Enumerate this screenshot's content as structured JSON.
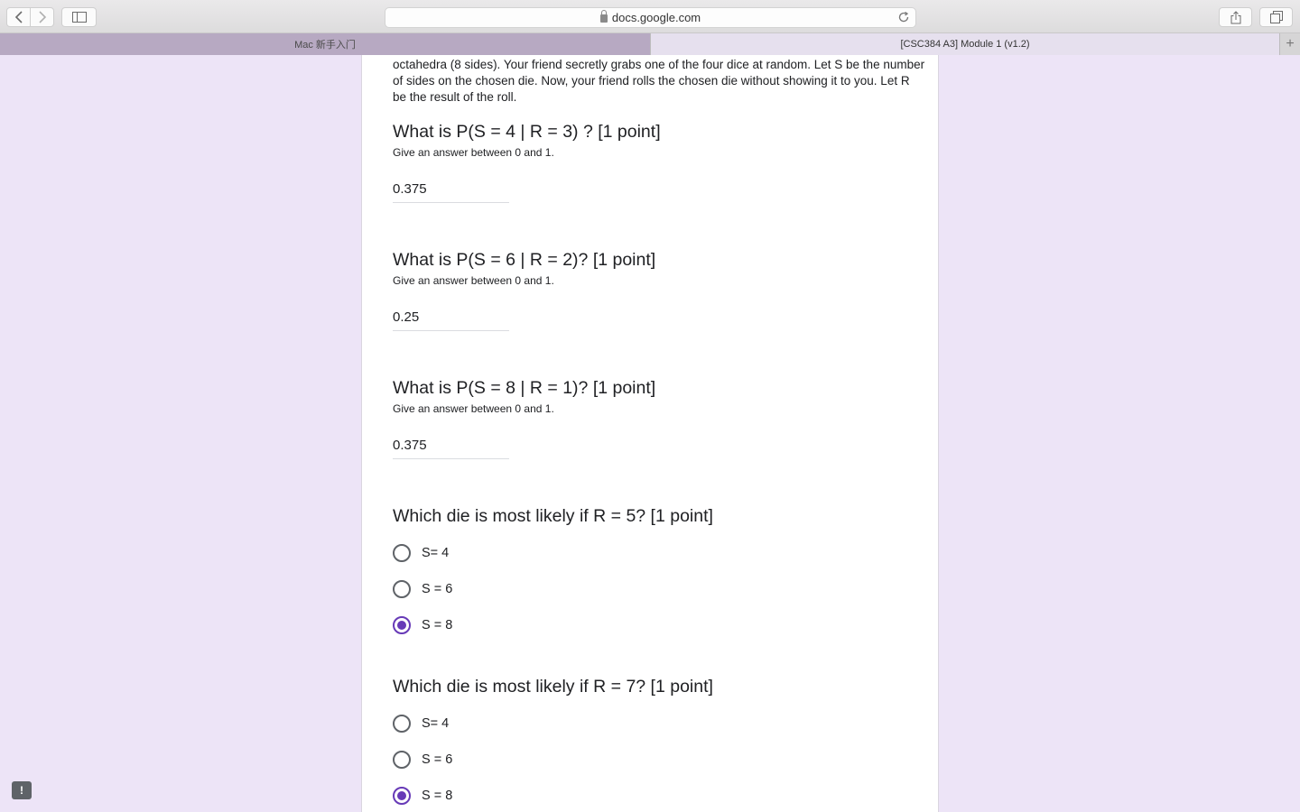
{
  "browser": {
    "url": "docs.google.com",
    "tabs": [
      {
        "label": "Mac 新手入门",
        "active": false
      },
      {
        "label": "[CSC384 A3] Module 1 (v1.2)",
        "active": true
      }
    ],
    "new_tab_label": "+"
  },
  "form": {
    "intro": "octahedra (8 sides). Your friend secretly grabs one of the four dice at random. Let S be the number of sides on the chosen die. Now, your friend rolls the chosen die without showing it to you. Let R be the result of the roll.",
    "short_questions": [
      {
        "title": "What is P(S = 4 | R = 3) ? [1 point]",
        "help": "Give an answer between 0 and 1.",
        "answer": "0.375"
      },
      {
        "title": "What is P(S = 6 | R = 2)? [1 point]",
        "help": "Give an answer between 0 and 1.",
        "answer": "0.25"
      },
      {
        "title": "What is P(S = 8 | R = 1)? [1 point]",
        "help": "Give an answer between 0 and 1.",
        "answer": "0.375"
      }
    ],
    "choice_questions": [
      {
        "title": "Which die is most likely if R = 5? [1 point]",
        "options": [
          "S= 4",
          "S = 6",
          "S = 8"
        ],
        "selected": "S = 8"
      },
      {
        "title": "Which die is most likely if R = 7? [1 point]",
        "options": [
          "S= 4",
          "S = 6",
          "S = 8"
        ],
        "selected": "S = 8"
      }
    ]
  },
  "feedback_label": "!",
  "colors": {
    "accent": "#673ab7",
    "background": "#ede4f7",
    "active_tab": "#b7a9c2"
  }
}
